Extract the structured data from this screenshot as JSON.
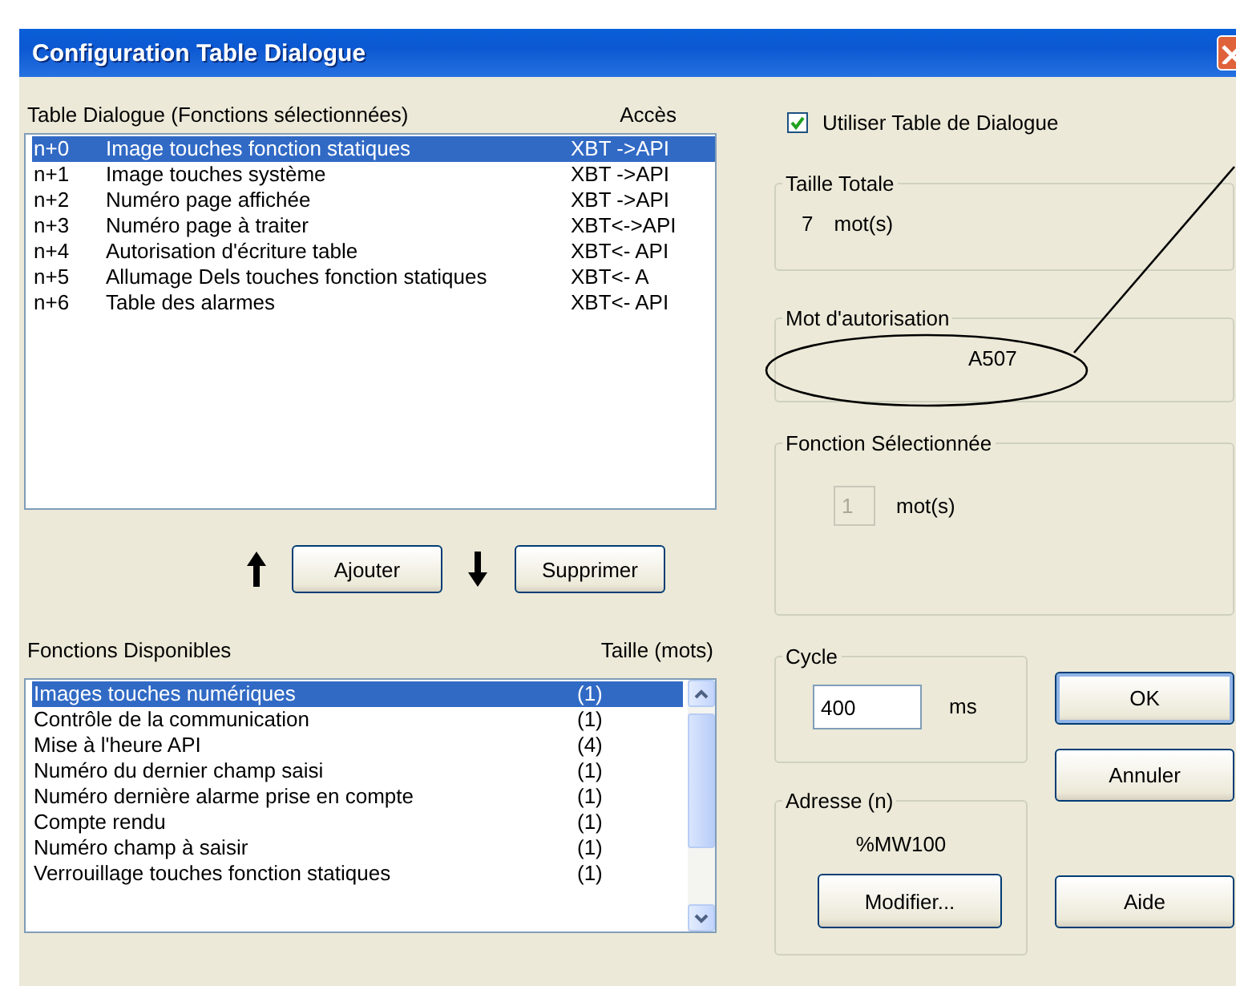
{
  "window": {
    "title": "Configuration Table Dialogue"
  },
  "selected_functions": {
    "label": "Table Dialogue (Fonctions sélectionnées)",
    "access_header": "Accès",
    "rows": [
      {
        "index": "n+0",
        "name": "Image touches fonction statiques",
        "access": "XBT ->API",
        "selected": true
      },
      {
        "index": "n+1",
        "name": "Image touches système",
        "access": "XBT ->API",
        "selected": false
      },
      {
        "index": "n+2",
        "name": "Numéro page affichée",
        "access": "XBT ->API",
        "selected": false
      },
      {
        "index": "n+3",
        "name": "Numéro page à traiter",
        "access": "XBT<->API",
        "selected": false
      },
      {
        "index": "n+4",
        "name": "Autorisation d'écriture table",
        "access": "XBT<- API",
        "selected": false
      },
      {
        "index": "n+5",
        "name": "Allumage Dels touches fonction statiques",
        "access": "XBT<- A",
        "selected": false
      },
      {
        "index": "n+6",
        "name": "Table des alarmes",
        "access": "XBT<- API",
        "selected": false
      }
    ]
  },
  "list_buttons": {
    "add": "Ajouter",
    "remove": "Supprimer"
  },
  "available_functions": {
    "label": "Fonctions Disponibles",
    "size_header": "Taille (mots)",
    "rows": [
      {
        "name": "Images touches numériques",
        "size": "(1)",
        "selected": true
      },
      {
        "name": "Contrôle de la communication",
        "size": "(1)",
        "selected": false
      },
      {
        "name": "Mise à l'heure API",
        "size": "(4)",
        "selected": false
      },
      {
        "name": "Numéro du dernier champ saisi",
        "size": "(1)",
        "selected": false
      },
      {
        "name": "Numéro dernière alarme prise en compte",
        "size": "(1)",
        "selected": false
      },
      {
        "name": "Compte rendu",
        "size": "(1)",
        "selected": false
      },
      {
        "name": "Numéro champ à saisir",
        "size": "(1)",
        "selected": false
      },
      {
        "name": "Verrouillage touches fonction statiques",
        "size": "(1)",
        "selected": false
      }
    ]
  },
  "use_table": {
    "label": "Utiliser Table de Dialogue",
    "checked": true
  },
  "total_size": {
    "title": "Taille Totale",
    "value": "7",
    "unit": "mot(s)"
  },
  "authorization_word": {
    "title": "Mot d'autorisation",
    "value": "A507"
  },
  "selected_function": {
    "title": "Fonction Sélectionnée",
    "value": "1",
    "disabled": true,
    "unit": "mot(s)"
  },
  "cycle": {
    "title": "Cycle",
    "value": "400",
    "unit": "ms"
  },
  "address": {
    "title": "Adresse (n)",
    "value": "%MW100",
    "button": "Modifier..."
  },
  "dialog_buttons": [
    {
      "label": "OK",
      "default": true
    },
    {
      "label": "Annuler",
      "default": false
    },
    {
      "label": "Aide",
      "default": false
    }
  ]
}
